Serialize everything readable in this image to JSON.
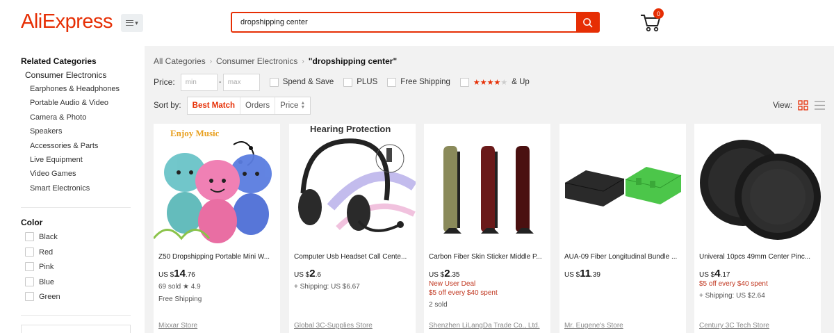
{
  "header": {
    "logo": "AliExpress",
    "search_value": "dropshipping center",
    "cart_count": "0"
  },
  "sidebar": {
    "related_title": "Related Categories",
    "category": "Consumer Electronics",
    "subcategories": [
      "Earphones & Headphones",
      "Portable Audio & Video",
      "Camera & Photo",
      "Speakers",
      "Accessories & Parts",
      "Live Equipment",
      "Video Games",
      "Smart Electronics"
    ],
    "color_title": "Color",
    "colors": [
      "Black",
      "Red",
      "Pink",
      "Blue",
      "Green"
    ]
  },
  "breadcrumb": {
    "items": [
      "All Categories",
      "Consumer Electronics"
    ],
    "current": "\"dropshipping center\""
  },
  "filters": {
    "price_label": "Price:",
    "min_placeholder": "min",
    "max_placeholder": "max",
    "dash": "-",
    "spend_save": "Spend & Save",
    "plus": "PLUS",
    "free_shipping": "Free Shipping",
    "rating_suffix": "& Up",
    "rating_value": 4
  },
  "sort": {
    "label": "Sort by:",
    "options": [
      "Best Match",
      "Orders",
      "Price"
    ],
    "active": "Best Match"
  },
  "view": {
    "label": "View:"
  },
  "products": [
    {
      "title": "Z50 Dropshipping Portable Mini W...",
      "price_prefix": "US $",
      "price_int": "14",
      "price_dec": ".76",
      "lines": [
        "69 sold ★ 4.9",
        "Free Shipping"
      ],
      "store": "Mixxar Store",
      "image_caption": "Enjoy Music"
    },
    {
      "title": "Computer Usb Headset Call Cente...",
      "price_prefix": "US $",
      "price_int": "2",
      "price_dec": ".6",
      "lines": [
        "+ Shipping: US $6.67"
      ],
      "store": "Global 3C-Supplies Store",
      "image_caption": "Hearing Protection"
    },
    {
      "title": "Carbon Fiber Skin Sticker Middle P...",
      "price_prefix": "US $",
      "price_int": "2",
      "price_dec": ".35",
      "lines": [
        "New User Deal",
        "$5 off every $40 spent",
        "2 sold"
      ],
      "store": "Shenzhen LiLangDa Trade Co., Ltd.",
      "image_caption": ""
    },
    {
      "title": "AUA-09 Fiber Longitudinal Bundle ...",
      "price_prefix": "US $",
      "price_int": "11",
      "price_dec": ".39",
      "lines": [],
      "store": "Mr. Eugene's Store",
      "image_caption": ""
    },
    {
      "title": "Univeral 10pcs 49mm Center Pinc...",
      "price_prefix": "US $",
      "price_int": "4",
      "price_dec": ".17",
      "lines": [
        "$5 off every $40 spent",
        "+ Shipping: US $2.64"
      ],
      "store": "Century 3C Tech Store",
      "image_caption": ""
    }
  ],
  "colors": {
    "brand": "#e62e04",
    "page_bg": "#f2f2f2",
    "deal_red": "#c0361f"
  }
}
